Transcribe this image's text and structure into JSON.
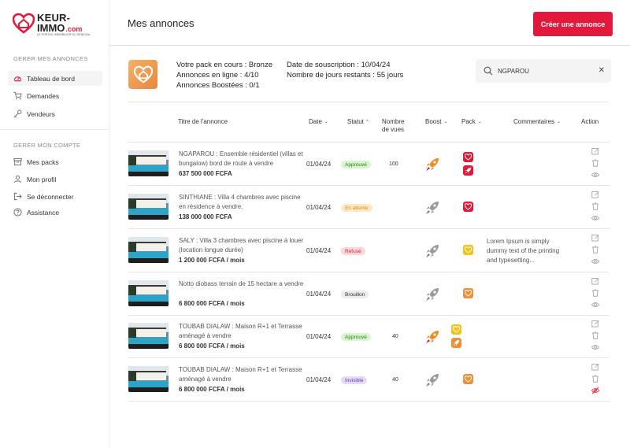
{
  "brand": {
    "line1": "KEUR-",
    "line2": "IMMO",
    "suffix": ".com",
    "tagline": "LE PORTAIL IMMOBILIER DU SENEGAL"
  },
  "sidebar": {
    "section1": "GERER MES ANNONCES",
    "section2": "GERER MON COMPTE",
    "items": [
      {
        "label": "Tableau de bord",
        "icon": "dashboard-icon"
      },
      {
        "label": "Demandes",
        "icon": "cart-icon"
      },
      {
        "label": "Vendeurs",
        "icon": "key-icon"
      },
      {
        "label": "Mes packs",
        "icon": "archive-icon"
      },
      {
        "label": "Mon profil",
        "icon": "user-icon"
      },
      {
        "label": "Se déconnecter",
        "icon": "logout-icon"
      },
      {
        "label": "Assistance",
        "icon": "help-icon"
      }
    ]
  },
  "header": {
    "title": "Mes annonces",
    "create_label": "Créer une annonce"
  },
  "pack": {
    "current": "Votre pack en cours : Bronze",
    "online": "Annonces en ligne : 4/10",
    "boosted": "Annonces Boostées : 0/1",
    "subscription": "Date de souscription : 10/04/24",
    "remaining": "Nombre de jours restants : 55 jours"
  },
  "search": {
    "value": "NGPAROU",
    "placeholder": ""
  },
  "table": {
    "headers": {
      "title": "Titre de l'annonce",
      "date": "Date",
      "status": "Statut",
      "views_1": "Nombre",
      "views_2": "de vues",
      "boost": "Boost",
      "pack": "Pack",
      "comments": "Commentaires",
      "action": "Action"
    },
    "rows": [
      {
        "title": "NGAPAROU : Ensemble résidentiel (villas et bungalow) bord de route à vendre",
        "price": "637 500 000 FCFA",
        "date": "01/04/24",
        "status": "Approuvé",
        "views": "100",
        "boost": "orange",
        "packs": [
          "red-heart",
          "red-rocket"
        ],
        "comment": ""
      },
      {
        "title": "SINTHIANE : Villa 4 chambres avec piscine en résidence à vendre.",
        "price": "138 000 000 FCFA",
        "date": "01/04/24",
        "status": "En attente",
        "views": "",
        "boost": "grey",
        "packs": [
          "red-heart"
        ],
        "comment": ""
      },
      {
        "title": "SALY : Villa 3 chambres avec piscine à louer (location longue durée)",
        "price": "1 200 000 FCFA / mois",
        "date": "01/04/24",
        "status": "Refusé",
        "views": "",
        "boost": "grey",
        "packs": [
          "yellow-heart"
        ],
        "comment": "Lorem Ipsum is simply dummy text of the printing and typesetting..."
      },
      {
        "title": "Notto diobass terrain de 15 hectare a vendre",
        "price": "6 800 000 FCFA / mois",
        "date": "01/04/24",
        "status": "Brouillon",
        "views": "",
        "boost": "grey",
        "packs": [
          "orange-heart"
        ],
        "comment": ""
      },
      {
        "title": "TOUBAB DIALAW : Maison R+1 et Terrasse aménagé à vendre",
        "price": "6 800 000 FCFA / mois",
        "date": "01/04/24",
        "status": "Approuvé",
        "views": "40",
        "boost": "orange",
        "packs": [
          "yellow-heart",
          "orange-rocket"
        ],
        "comment": ""
      },
      {
        "title": "TOUBAB DIALAW : Maison R+1 et Terrasse aménagé à vendre",
        "price": "6 800 000 FCFA / mois",
        "date": "01/04/24",
        "status": "Invisible",
        "views": "40",
        "boost": "grey",
        "packs": [
          "orange-heart"
        ],
        "comment": ""
      }
    ]
  },
  "colors": {
    "brand_red": "#e2193c",
    "approved_bg": "#d9f5d0",
    "approved_fg": "#2a7a1a",
    "pending_bg": "#fde9c6",
    "pending_fg": "#e08a12",
    "refused_bg": "#fcd6da",
    "refused_fg": "#d0283d",
    "draft_bg": "#ececec",
    "draft_fg": "#333333",
    "invisible_bg": "#e6d9f7",
    "invisible_fg": "#6a3bb0"
  }
}
